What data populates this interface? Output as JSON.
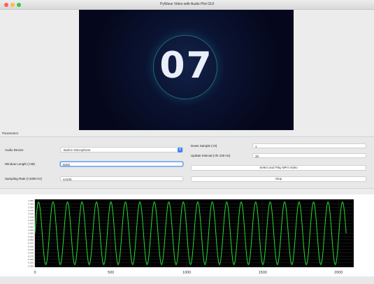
{
  "window": {
    "title": "PyWave Video with Audio Plot GUI"
  },
  "video": {
    "countdown": "07"
  },
  "params": {
    "section_label": "Parameters",
    "audio_device_label": "Audio Device",
    "audio_device_value": "Built-in Microphone",
    "window_length_label": "Window Length (>49)",
    "window_length_value": "5000",
    "sampling_rate_label": "Sampling Rate (<1000 Hz)",
    "sampling_rate_value": "44100",
    "down_sample_label": "Down Sample (>0)",
    "down_sample_value": "1",
    "update_interval_label": "Update Interval (<fs 100 Hz)",
    "update_interval_value": "30",
    "select_play_label": "Select and Play MP4 Video",
    "stop_label": "Stop"
  },
  "chart_data": {
    "type": "line",
    "title": "",
    "xlabel": "",
    "ylabel": "",
    "xlim": [
      0,
      2100
    ],
    "xticks": [
      0,
      500,
      1000,
      1500,
      2000
    ],
    "ylim": [
      -0.26,
      0.26
    ],
    "yticks": [
      -0.25,
      -0.225,
      -0.2,
      -0.175,
      -0.15,
      -0.125,
      -0.1,
      -0.075,
      -0.05,
      -0.025,
      0.0,
      0.025,
      0.05,
      0.075,
      0.1,
      0.125,
      0.15,
      0.175,
      0.2,
      0.225,
      0.25
    ],
    "background": "#000000",
    "grid": true,
    "series": [
      {
        "color": "#22dd33",
        "waveform": "sine",
        "amplitude": 0.24,
        "cycles": 21.5,
        "x_start": 0,
        "x_end": 2050
      }
    ]
  }
}
